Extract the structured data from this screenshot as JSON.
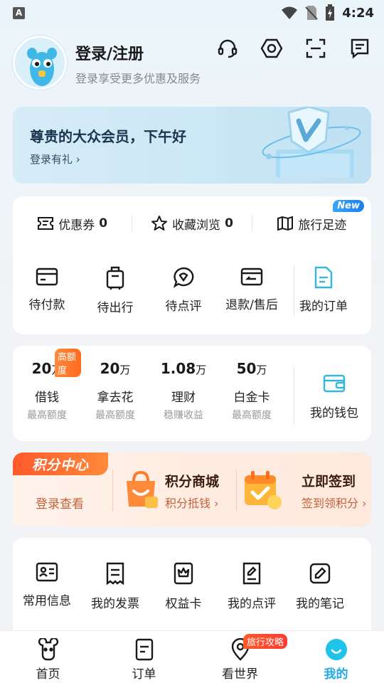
{
  "status_bar": {
    "app_badge": "A",
    "time": "4:24"
  },
  "header": {
    "title": "登录/注册",
    "subtitle": "登录享受更多优惠及服务"
  },
  "vip": {
    "title": "尊贵的大众会员，下午好",
    "link": "登录有礼 ›"
  },
  "stats": [
    {
      "label": "优惠券",
      "count": "0"
    },
    {
      "label": "收藏浏览",
      "count": "0"
    },
    {
      "label": "旅行足迹",
      "count": "",
      "badge": "New"
    }
  ],
  "orders": [
    {
      "label": "待付款"
    },
    {
      "label": "待出行"
    },
    {
      "label": "待点评"
    },
    {
      "label": "退款/售后"
    },
    {
      "label": "我的订单"
    }
  ],
  "wallet": {
    "items": [
      {
        "value": "20",
        "unit": "万",
        "name": "借钱",
        "sub": "最高额度",
        "badge": "高额度"
      },
      {
        "value": "20",
        "unit": "万",
        "name": "拿去花",
        "sub": "最高额度"
      },
      {
        "value": "1.08",
        "unit": "万",
        "name": "理财",
        "sub": "稳赚收益"
      },
      {
        "value": "50",
        "unit": "万",
        "name": "白金卡",
        "sub": "最高额度"
      }
    ],
    "main_label": "我的钱包"
  },
  "points": {
    "tag": "积分中心",
    "login": "登录查看",
    "mall_title": "积分商城",
    "mall_sub": "积分抵钱 ›",
    "checkin_title": "立即签到",
    "checkin_sub": "签到领积分 ›"
  },
  "tools": [
    {
      "label": "常用信息"
    },
    {
      "label": "我的发票"
    },
    {
      "label": "权益卡"
    },
    {
      "label": "我的点评"
    },
    {
      "label": "我的笔记"
    }
  ],
  "tabs": [
    {
      "label": "首页"
    },
    {
      "label": "订单"
    },
    {
      "label": "看世界",
      "badge": "旅行攻略"
    },
    {
      "label": "我的"
    }
  ],
  "colors": {
    "accent": "#1fa9e6",
    "orange": "#ff6b1f",
    "teal": "#35b7dd"
  }
}
